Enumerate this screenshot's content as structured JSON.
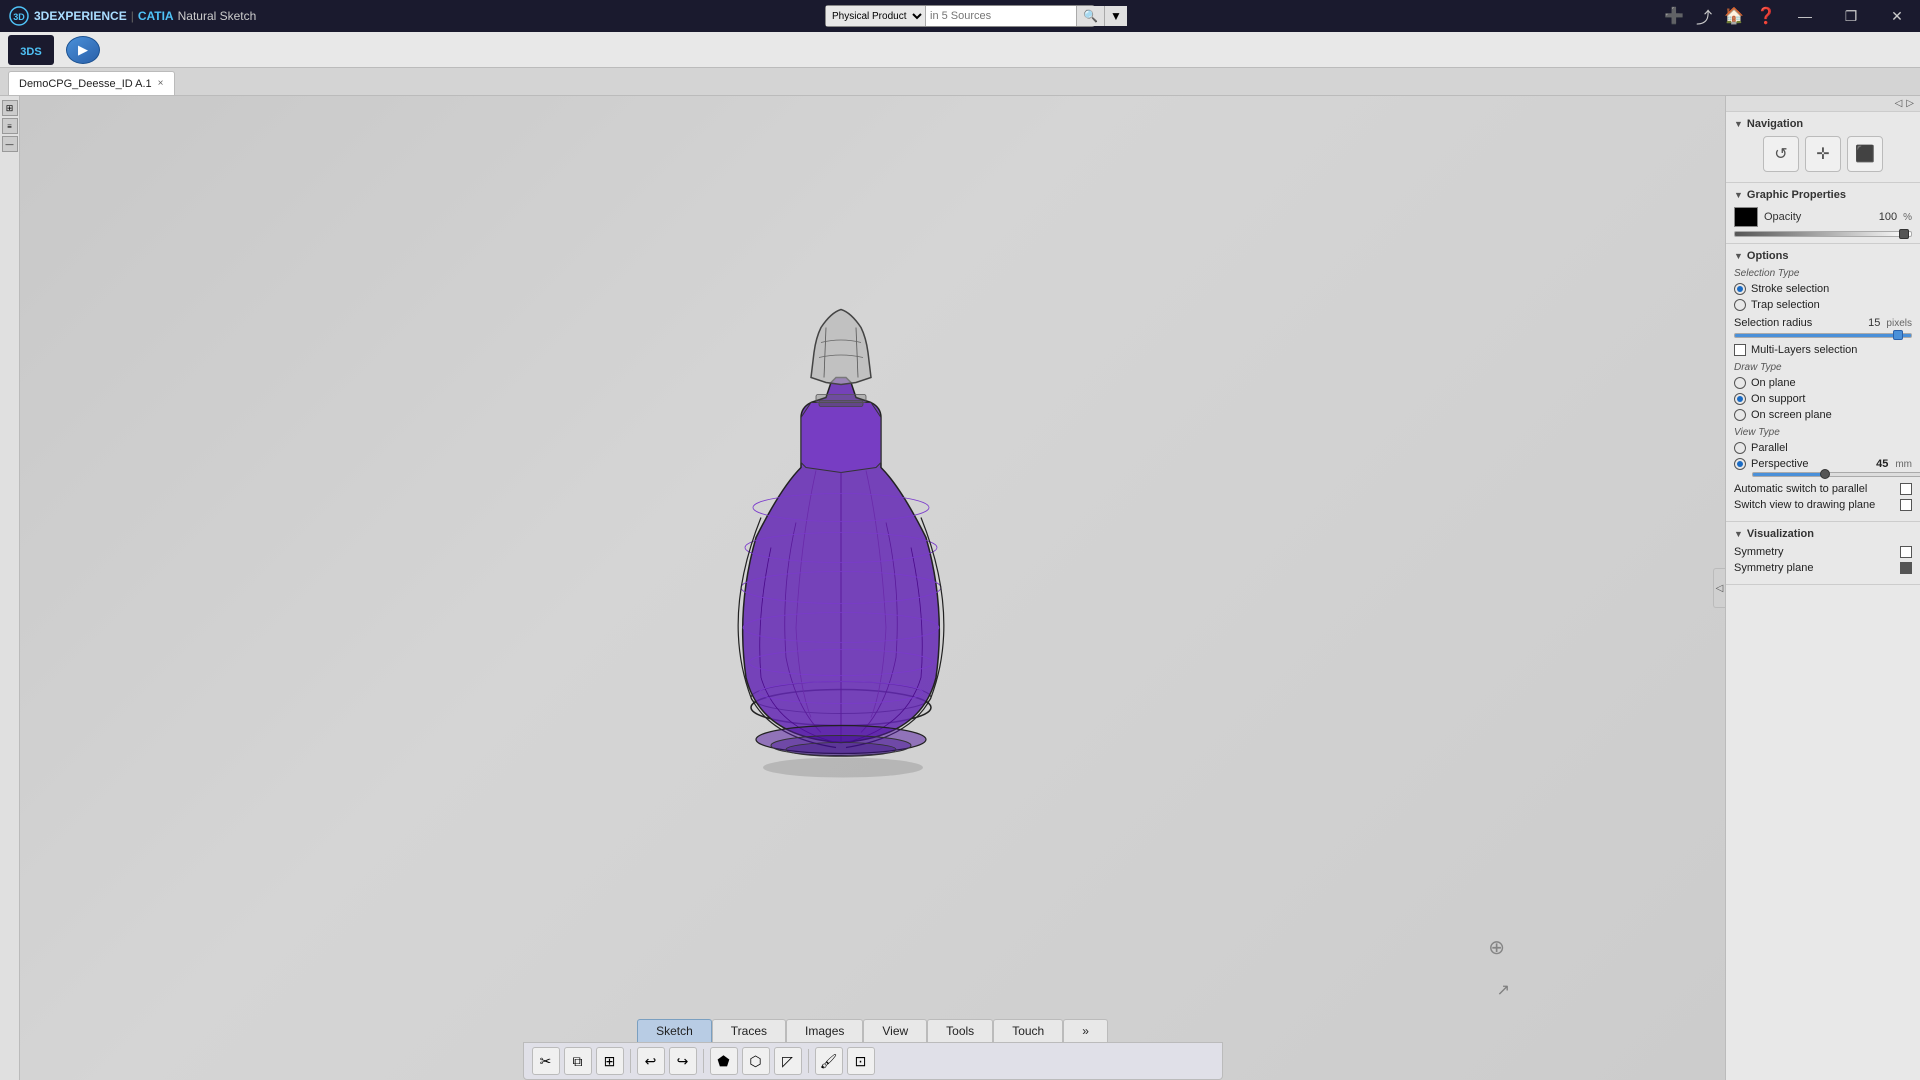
{
  "titlebar": {
    "app_name": "3DEXPERIENCE",
    "separator": "|",
    "catia_label": "CATIA",
    "product_label": "Natural Sketch",
    "window_title": "3DEXPERIENCE",
    "search_placeholder": "in 5 Sources",
    "search_product": "Physical Product",
    "minimize": "—",
    "restore": "❐",
    "close": "✕"
  },
  "tab_bar": {
    "tab_label": "DemoCPG_Deesse_ID A.1",
    "close": "×"
  },
  "right_panel": {
    "navigation_title": "Navigation",
    "nav_buttons": [
      {
        "icon": "↺",
        "label": "rotate"
      },
      {
        "icon": "+",
        "label": "pan"
      },
      {
        "icon": "⬜",
        "label": "zoom-fit"
      }
    ],
    "graphic_props_title": "Graphic Properties",
    "opacity_label": "Opacity",
    "opacity_value": "100",
    "opacity_unit": "%",
    "options_title": "Options",
    "selection_type_title": "Selection Type",
    "stroke_selection_label": "Stroke selection",
    "trap_selection_label": "Trap selection",
    "selection_radius_label": "Selection radius",
    "selection_radius_value": "15",
    "selection_radius_unit": "pixels",
    "multi_layers_label": "Multi-Layers selection",
    "draw_type_title": "Draw Type",
    "on_plane_label": "On plane",
    "on_support_label": "On support",
    "on_screen_plane_label": "On screen plane",
    "view_type_title": "View Type",
    "parallel_label": "Parallel",
    "perspective_label": "Perspective",
    "perspective_value": "45",
    "perspective_unit": "mm",
    "auto_switch_label": "Automatic switch to parallel",
    "switch_drawing_label": "Switch view to drawing plane",
    "visualization_title": "Visualization",
    "symmetry_label": "Symmetry",
    "symmetry_plane_label": "Symmetry plane"
  },
  "bottom_tabs": [
    {
      "label": "Sketch",
      "active": true
    },
    {
      "label": "Traces",
      "active": false
    },
    {
      "label": "Images",
      "active": false
    },
    {
      "label": "View",
      "active": false
    },
    {
      "label": "Tools",
      "active": false
    },
    {
      "label": "Touch",
      "active": false
    }
  ],
  "bottom_tools": [
    {
      "icon": "✂",
      "name": "scissors"
    },
    {
      "icon": "📋",
      "name": "copy"
    },
    {
      "icon": "⊞",
      "name": "duplicate"
    },
    {
      "icon": "↩",
      "name": "undo"
    },
    {
      "icon": "⬟",
      "name": "shape1"
    },
    {
      "icon": "⬠",
      "name": "shape2"
    },
    {
      "icon": "⊿",
      "name": "triangle"
    },
    {
      "icon": "🖌",
      "name": "brush"
    },
    {
      "icon": "⊡",
      "name": "box"
    }
  ]
}
